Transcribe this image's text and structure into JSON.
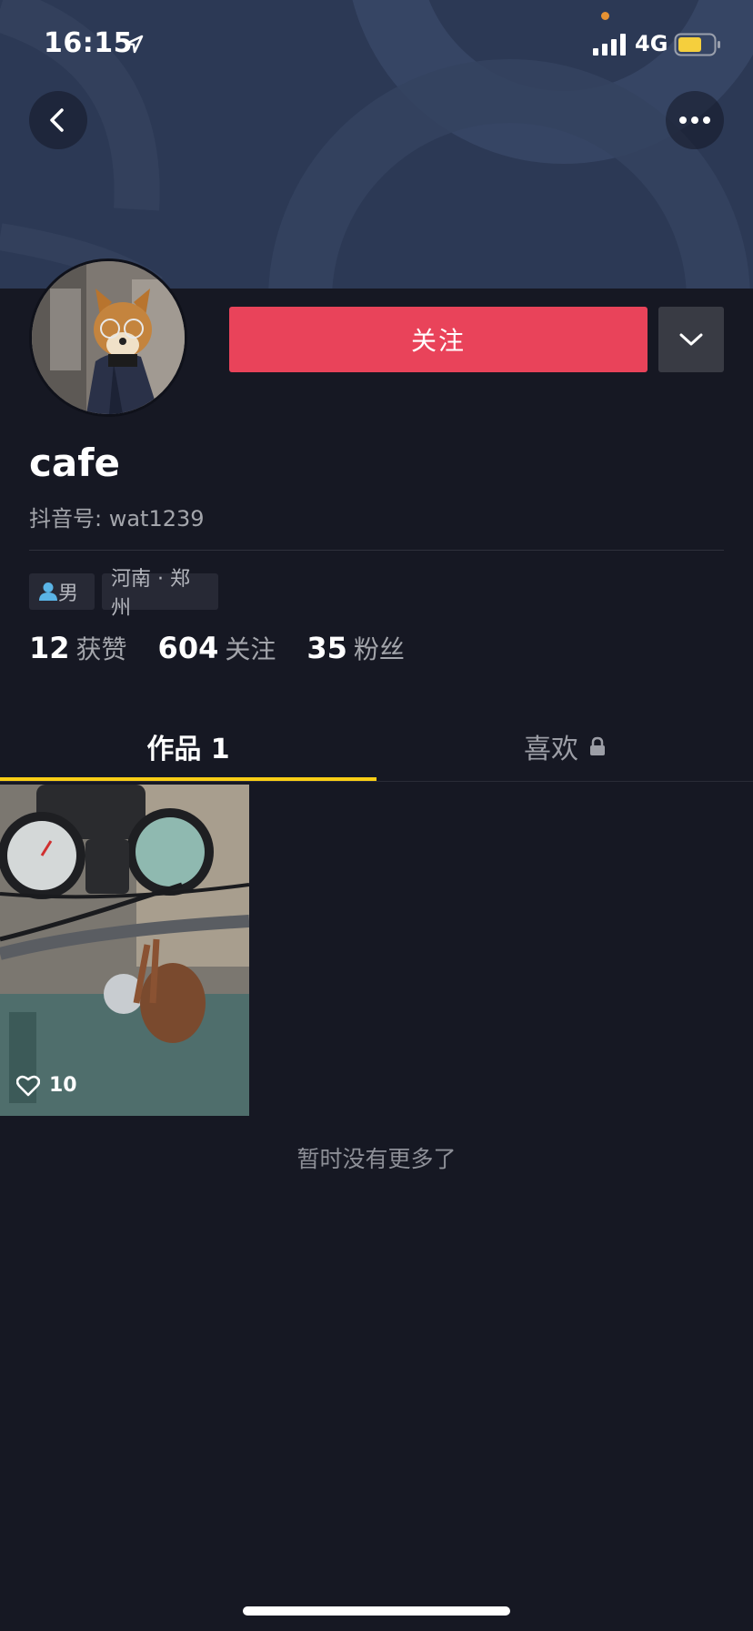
{
  "status_bar": {
    "time": "16:15",
    "network": "4G",
    "icons": [
      "location-arrow-icon",
      "signal-bars-icon",
      "battery-icon"
    ]
  },
  "header": {
    "icons": [
      "chevron-left-icon",
      "more-dots-icon"
    ]
  },
  "profile": {
    "follow_label": "关注",
    "username": "cafe",
    "douyin_id": "抖音号: wat1239",
    "gender": "男",
    "location": "河南 · 郑州",
    "stats": [
      {
        "value": "12",
        "label": "获赞"
      },
      {
        "value": "604",
        "label": "关注"
      },
      {
        "value": "35",
        "label": "粉丝"
      }
    ]
  },
  "tabs": [
    {
      "label": "作品 1",
      "active": true
    },
    {
      "label": "喜欢",
      "locked": true,
      "active": false
    }
  ],
  "videos": [
    {
      "likes": "10"
    }
  ],
  "footer": {
    "no_more": "暂时没有更多了"
  },
  "colors": {
    "background": "#161823",
    "banner": "#2c3955",
    "follow_button": "#e9435a",
    "tab_indicator": "#face15",
    "battery_fill": "#f5cf3d"
  }
}
